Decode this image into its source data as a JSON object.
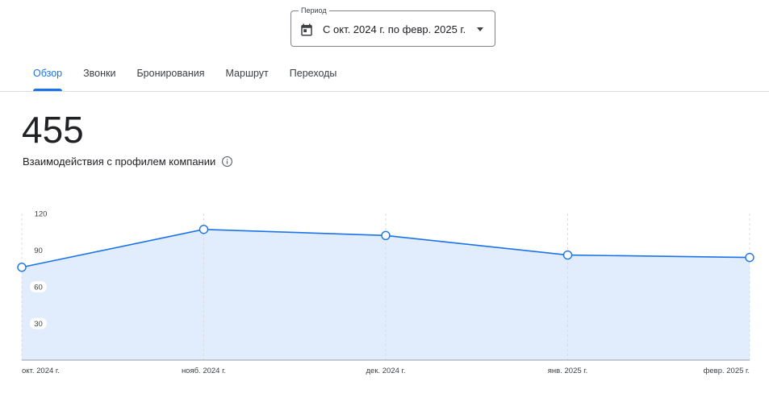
{
  "period": {
    "label": "Период",
    "value": "С окт. 2024 г. по февр. 2025 г."
  },
  "tabs": [
    {
      "label": "Обзор",
      "active": true
    },
    {
      "label": "Звонки",
      "active": false
    },
    {
      "label": "Бронирования",
      "active": false
    },
    {
      "label": "Маршрут",
      "active": false
    },
    {
      "label": "Переходы",
      "active": false
    }
  ],
  "summary": {
    "total": "455",
    "label": "Взаимодействия с профилем компании"
  },
  "colors": {
    "accent": "#1a73e8",
    "area_fill": "#e1ecfd",
    "text": "#202124"
  },
  "icons": [
    "calendar-icon",
    "dropdown-arrow-icon",
    "info-icon"
  ],
  "chart_data": {
    "type": "area",
    "categories": [
      "окт. 2024 г.",
      "нояб. 2024 г.",
      "дек. 2024 г.",
      "янв. 2025 г.",
      "февр. 2025 г."
    ],
    "series": [
      {
        "values": [
          76,
          107,
          102,
          86,
          84
        ]
      }
    ],
    "yticks": [
      "120",
      "90",
      "60",
      "30"
    ],
    "ylim": [
      0,
      120
    ],
    "grid": "vertical-dashed"
  }
}
